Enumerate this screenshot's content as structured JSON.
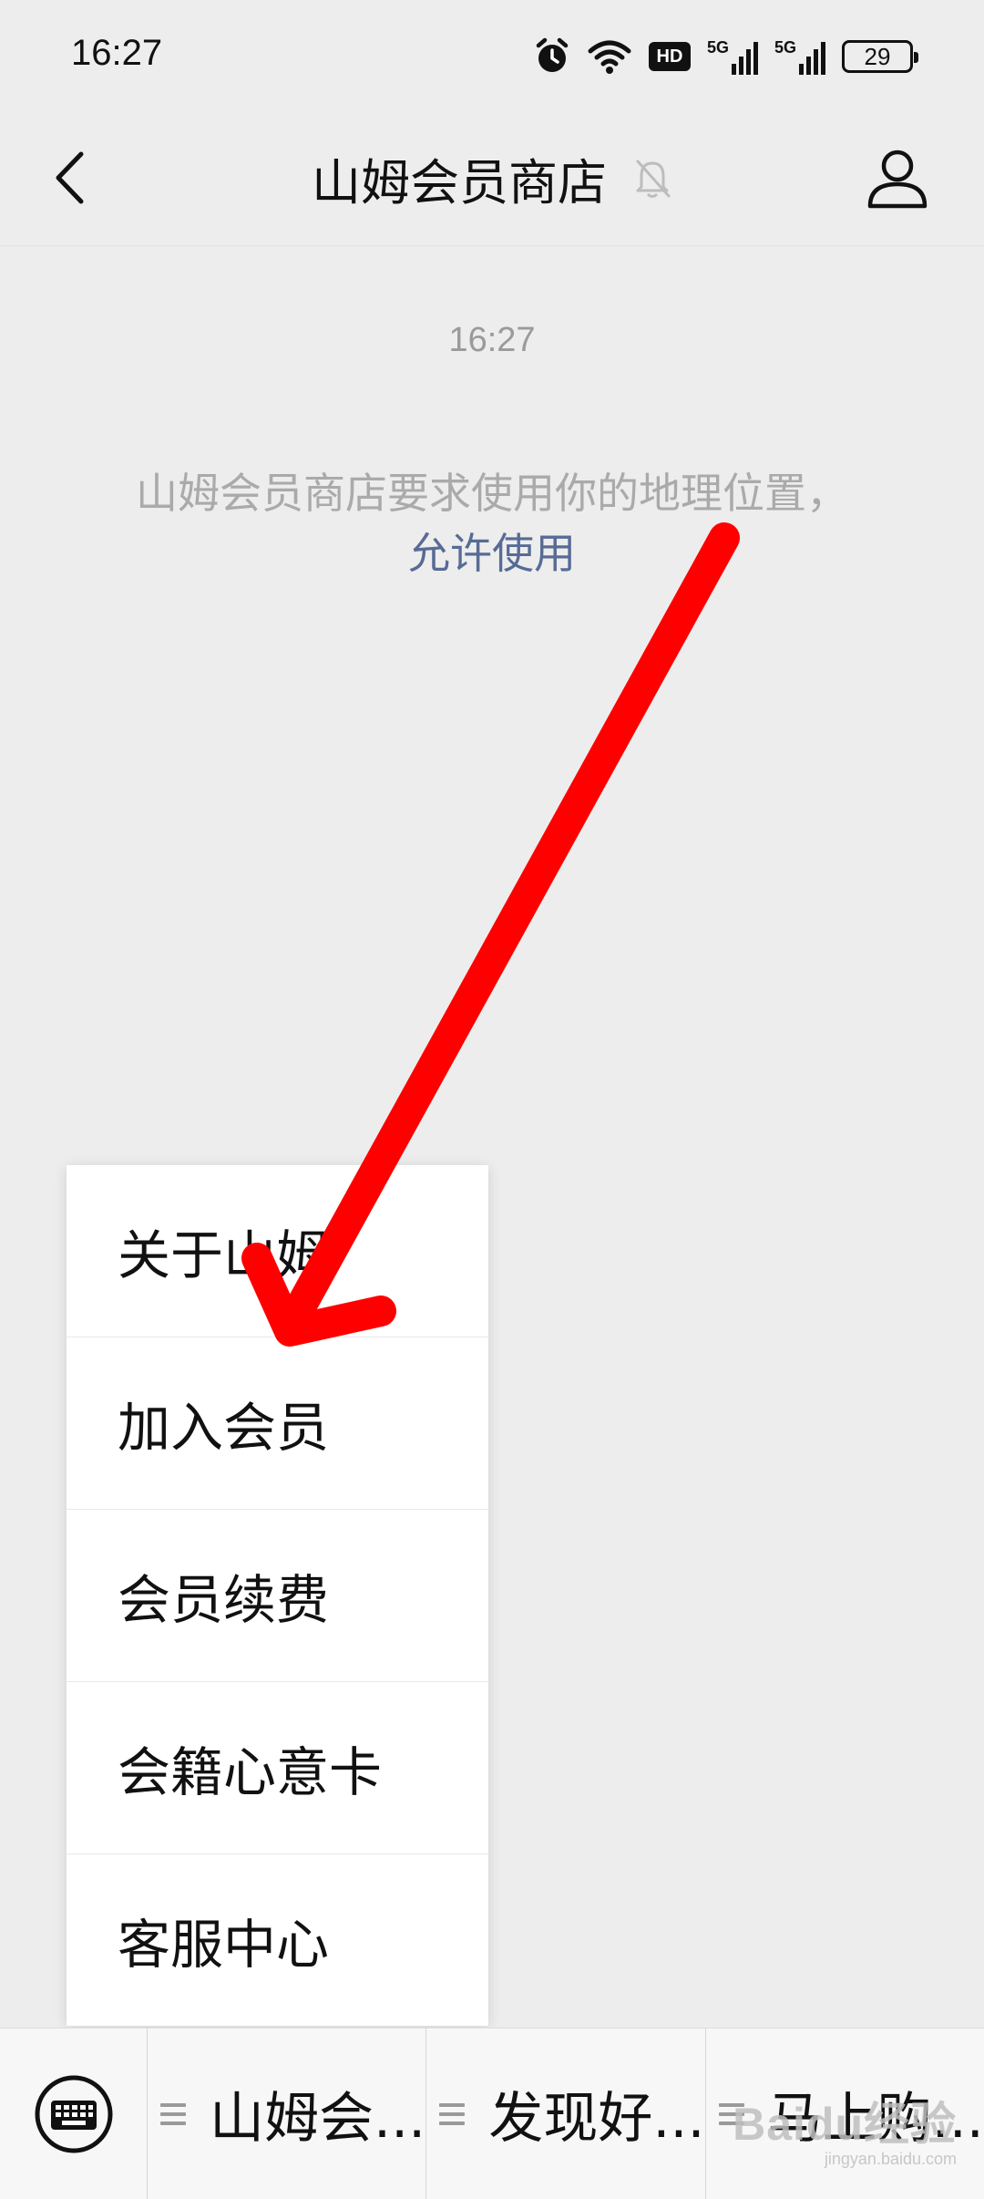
{
  "status_bar": {
    "time": "16:27",
    "icons": [
      "alarm-icon",
      "wifi-icon",
      "hd-icon",
      "signal-5g-icon",
      "signal-5g-icon",
      "battery-icon"
    ],
    "hd_label": "HD",
    "net_label_1": "5G",
    "net_label_2": "5G",
    "battery": "29"
  },
  "header": {
    "title": "山姆会员商店",
    "back_icon": "chevron-left-icon",
    "mute_icon": "bell-off-icon",
    "profile_icon": "person-icon"
  },
  "chat": {
    "timestamp": "16:27",
    "system_message": "山姆会员商店要求使用你的地理位置，",
    "allow_link": "允许使用"
  },
  "popup_menu": {
    "items": [
      {
        "label": "关于山姆"
      },
      {
        "label": "加入会员"
      },
      {
        "label": "会员续费"
      },
      {
        "label": "会籍心意卡"
      },
      {
        "label": "客服中心"
      }
    ]
  },
  "bottom_menu": {
    "keyboard_icon": "keyboard-icon",
    "tabs": [
      {
        "label": "山姆会..."
      },
      {
        "label": "发现好..."
      },
      {
        "label": "马上购..."
      }
    ]
  },
  "watermark": {
    "logo": "Baidu经验",
    "url": "jingyan.baidu.com"
  },
  "colors": {
    "background": "#ededed",
    "link": "#576b95",
    "arrow": "#ff0000",
    "muted_text": "#aaaaaa"
  }
}
